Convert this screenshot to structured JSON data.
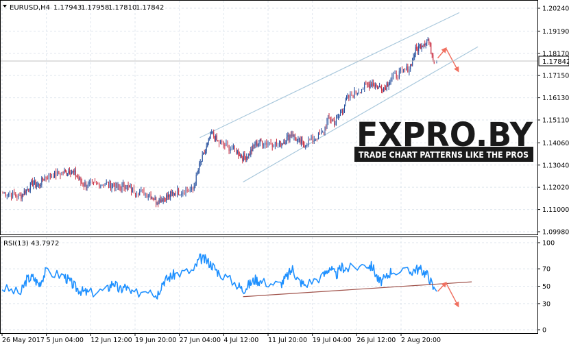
{
  "main_panel": {
    "symbol_header": "EURUSD,H4",
    "ohlc": [
      "1.17943",
      "1.17958",
      "1.17810",
      "1.17842"
    ],
    "price_ticks": [
      "1.20240",
      "1.19190",
      "1.18170",
      "1.17150",
      "1.16130",
      "1.15110",
      "1.14060",
      "1.13040",
      "1.12020",
      "1.11000",
      "1.09980"
    ],
    "current_price_label": "1.17842"
  },
  "rsi_panel": {
    "header": "RSI(13) 43.7972",
    "ticks": [
      "100",
      "70",
      "50",
      "30",
      "0"
    ]
  },
  "time_axis": {
    "labels": [
      "26 May 2017",
      "5 Jun 04:00",
      "12 Jun 12:00",
      "19 Jun 20:00",
      "27 Jun 04:00",
      "4 Jul 12:00",
      "11 Jul 20:00",
      "19 Jul 04:00",
      "26 Jul 12:00",
      "2 Aug 20:00"
    ]
  },
  "watermark": {
    "logo_text": "FXPRO.BY",
    "tagline": "TRADE CHART PATTERNS LIKE THE PROS"
  },
  "colors": {
    "bull_candle": "#1f4a9a",
    "bear_candle": "#c8283c",
    "rsi_line": "#1e90ff",
    "channel_line": "#a9c8dc",
    "rsi_trendline": "#a0524a",
    "arrow": "#f07060",
    "grid": "#dfe6ee"
  },
  "chart_data": [
    {
      "type": "candlestick",
      "title": "EURUSD,H4",
      "ylim": [
        1.0998,
        1.2024
      ],
      "x_start": "2017-05-26",
      "x_end": "2017-08-04",
      "close_series": [
        [
          "2017-05-26",
          1.118
        ],
        [
          "2017-05-29",
          1.116
        ],
        [
          "2017-05-30",
          1.119
        ],
        [
          "2017-05-31",
          1.122
        ],
        [
          "2017-06-01",
          1.121
        ],
        [
          "2017-06-02",
          1.125
        ],
        [
          "2017-06-05",
          1.127
        ],
        [
          "2017-06-06",
          1.128
        ],
        [
          "2017-06-07",
          1.126
        ],
        [
          "2017-06-08",
          1.122
        ],
        [
          "2017-06-09",
          1.121
        ],
        [
          "2017-06-12",
          1.122
        ],
        [
          "2017-06-13",
          1.121
        ],
        [
          "2017-06-14",
          1.12
        ],
        [
          "2017-06-15",
          1.121
        ],
        [
          "2017-06-16",
          1.119
        ],
        [
          "2017-06-19",
          1.117
        ],
        [
          "2017-06-20",
          1.114
        ],
        [
          "2017-06-21",
          1.115
        ],
        [
          "2017-06-22",
          1.116
        ],
        [
          "2017-06-23",
          1.118
        ],
        [
          "2017-06-26",
          1.119
        ],
        [
          "2017-06-27",
          1.13
        ],
        [
          "2017-06-28",
          1.137
        ],
        [
          "2017-06-29",
          1.145
        ],
        [
          "2017-06-30",
          1.141
        ],
        [
          "2017-07-03",
          1.137
        ],
        [
          "2017-07-04",
          1.134
        ],
        [
          "2017-07-05",
          1.135
        ],
        [
          "2017-07-06",
          1.14
        ],
        [
          "2017-07-07",
          1.141
        ],
        [
          "2017-07-10",
          1.14
        ],
        [
          "2017-07-11",
          1.142
        ],
        [
          "2017-07-12",
          1.145
        ],
        [
          "2017-07-13",
          1.141
        ],
        [
          "2017-07-14",
          1.14
        ],
        [
          "2017-07-17",
          1.145
        ],
        [
          "2017-07-18",
          1.152
        ],
        [
          "2017-07-19",
          1.15
        ],
        [
          "2017-07-20",
          1.155
        ],
        [
          "2017-07-21",
          1.161
        ],
        [
          "2017-07-24",
          1.167
        ],
        [
          "2017-07-25",
          1.168
        ],
        [
          "2017-07-26",
          1.166
        ],
        [
          "2017-07-27",
          1.166
        ],
        [
          "2017-07-28",
          1.17
        ],
        [
          "2017-07-31",
          1.175
        ],
        [
          "2017-08-01",
          1.183
        ],
        [
          "2017-08-02",
          1.186
        ],
        [
          "2017-08-03",
          1.188
        ],
        [
          "2017-08-04",
          1.1784
        ]
      ],
      "channel": {
        "upper": [
          [
            "2017-06-27",
            1.143
          ],
          [
            "2017-08-08",
            1.2004
          ]
        ],
        "lower": [
          [
            "2017-07-04",
            1.1226
          ],
          [
            "2017-08-11",
            1.1847
          ]
        ]
      },
      "projection": {
        "up_to": 1.184,
        "then_down_to": 1.1735
      }
    },
    {
      "type": "line",
      "title": "RSI(13) 43.7972",
      "ylim": [
        0,
        100
      ],
      "series": [
        {
          "values": [
            [
              "2017-05-26",
              48
            ],
            [
              "2017-05-29",
              42
            ],
            [
              "2017-05-30",
              58
            ],
            [
              "2017-05-31",
              60
            ],
            [
              "2017-06-01",
              52
            ],
            [
              "2017-06-02",
              66
            ],
            [
              "2017-06-05",
              62
            ],
            [
              "2017-06-06",
              55
            ],
            [
              "2017-06-07",
              48
            ],
            [
              "2017-06-08",
              44
            ],
            [
              "2017-06-09",
              42
            ],
            [
              "2017-06-12",
              46
            ],
            [
              "2017-06-13",
              55
            ],
            [
              "2017-06-14",
              45
            ],
            [
              "2017-06-15",
              50
            ],
            [
              "2017-06-16",
              40
            ],
            [
              "2017-06-19",
              48
            ],
            [
              "2017-06-20",
              39
            ],
            [
              "2017-06-21",
              55
            ],
            [
              "2017-06-22",
              60
            ],
            [
              "2017-06-23",
              64
            ],
            [
              "2017-06-26",
              68
            ],
            [
              "2017-06-27",
              82
            ],
            [
              "2017-06-28",
              80
            ],
            [
              "2017-06-29",
              74
            ],
            [
              "2017-06-30",
              66
            ],
            [
              "2017-07-03",
              52
            ],
            [
              "2017-07-04",
              46
            ],
            [
              "2017-07-05",
              52
            ],
            [
              "2017-07-06",
              58
            ],
            [
              "2017-07-07",
              55
            ],
            [
              "2017-07-10",
              52
            ],
            [
              "2017-07-11",
              60
            ],
            [
              "2017-07-12",
              70
            ],
            [
              "2017-07-13",
              56
            ],
            [
              "2017-07-14",
              52
            ],
            [
              "2017-07-17",
              62
            ],
            [
              "2017-07-18",
              72
            ],
            [
              "2017-07-19",
              62
            ],
            [
              "2017-07-20",
              72
            ],
            [
              "2017-07-21",
              70
            ],
            [
              "2017-07-24",
              75
            ],
            [
              "2017-07-25",
              72
            ],
            [
              "2017-07-26",
              55
            ],
            [
              "2017-07-27",
              58
            ],
            [
              "2017-07-28",
              68
            ],
            [
              "2017-07-31",
              66
            ],
            [
              "2017-08-01",
              70
            ],
            [
              "2017-08-02",
              68
            ],
            [
              "2017-08-03",
              62
            ],
            [
              "2017-08-04",
              44
            ]
          ]
        }
      ],
      "trendline": [
        [
          "2017-07-04",
          38
        ],
        [
          "2017-08-10",
          55
        ]
      ],
      "projection": {
        "up_to": 54,
        "then_down_to": 27
      }
    }
  ]
}
